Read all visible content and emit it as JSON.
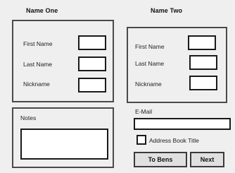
{
  "name_one": {
    "title": "Name One",
    "first_name_label": "First Name",
    "last_name_label": "Last Name",
    "nickname_label": "Nickname",
    "first_name_value": "",
    "last_name_value": "",
    "nickname_value": ""
  },
  "name_two": {
    "title": "Name Two",
    "first_name_label": "First Name",
    "last_name_label": "Last Name",
    "nickname_label": "Nickname",
    "first_name_value": "",
    "last_name_value": "",
    "nickname_value": ""
  },
  "notes": {
    "label": "Notes",
    "value": ""
  },
  "email": {
    "label": "E-Mail",
    "value": ""
  },
  "address_book": {
    "label": "Address Book Title",
    "checked": false
  },
  "buttons": {
    "to_bens": "To Bens",
    "next": "Next"
  }
}
